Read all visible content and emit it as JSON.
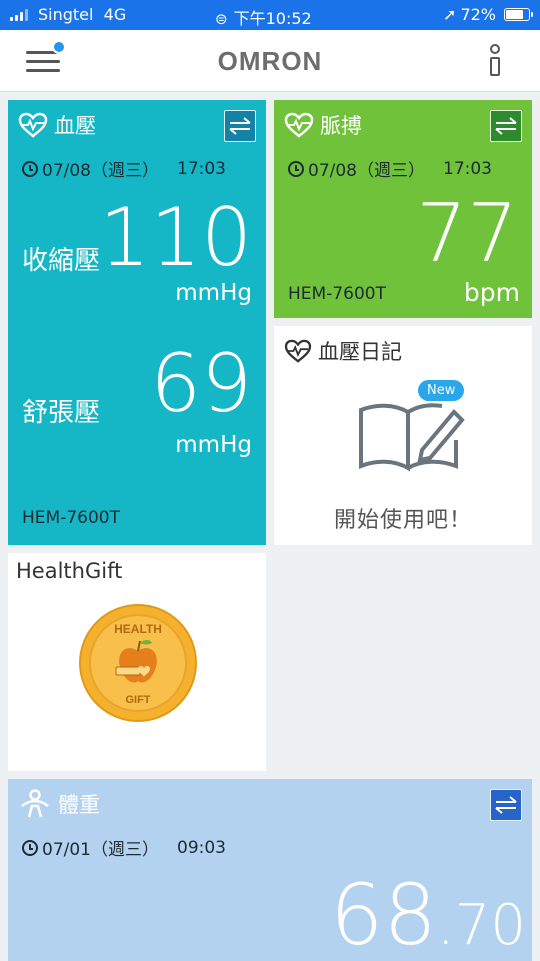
{
  "status_bar": {
    "carrier": "Singtel",
    "network": "4G",
    "time": "下午10:52",
    "battery_percent": "72%",
    "battery_level": 0.72
  },
  "header": {
    "logo": "OMRON",
    "menu_icon": "hamburger-menu-icon",
    "info_icon": "info-icon"
  },
  "blood_pressure": {
    "title": "血壓",
    "date": "07/08（週三）",
    "time": "17:03",
    "systolic_label": "收縮壓",
    "systolic_value": "110",
    "systolic_unit": "mmHg",
    "diastolic_label": "舒張壓",
    "diastolic_value": "69",
    "diastolic_unit": "mmHg",
    "model": "HEM-7600T",
    "color": "#15b7c6"
  },
  "pulse": {
    "title": "脈搏",
    "date": "07/08（週三）",
    "time": "17:03",
    "value": "77",
    "unit": "bpm",
    "model": "HEM-7600T",
    "color": "#6fc23a"
  },
  "diary": {
    "title": "血壓日記",
    "badge": "New",
    "cta": "開始使用吧！"
  },
  "healthgift": {
    "title": "HealthGift",
    "coin_top": "HEALTH",
    "coin_bottom": "GIFT"
  },
  "weight": {
    "title": "體重",
    "date": "07/01（週三）",
    "time": "09:03",
    "value_int": "68",
    "value_dec": ".70",
    "color": "#b3d2ef"
  }
}
